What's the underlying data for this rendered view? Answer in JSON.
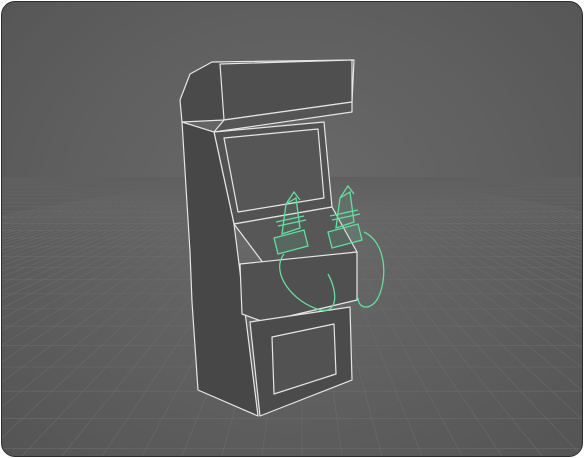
{
  "viewport": {
    "background_color": "#5f5f5f",
    "grid_color": "#6b6b6b",
    "wireframe_color": "#e6e6e6",
    "selection_color": "#5fe0a0"
  },
  "scene": {
    "object": "arcade-cabinet",
    "selected_objects": [
      "joystick-left",
      "joystick-right",
      "controller-cables"
    ]
  }
}
